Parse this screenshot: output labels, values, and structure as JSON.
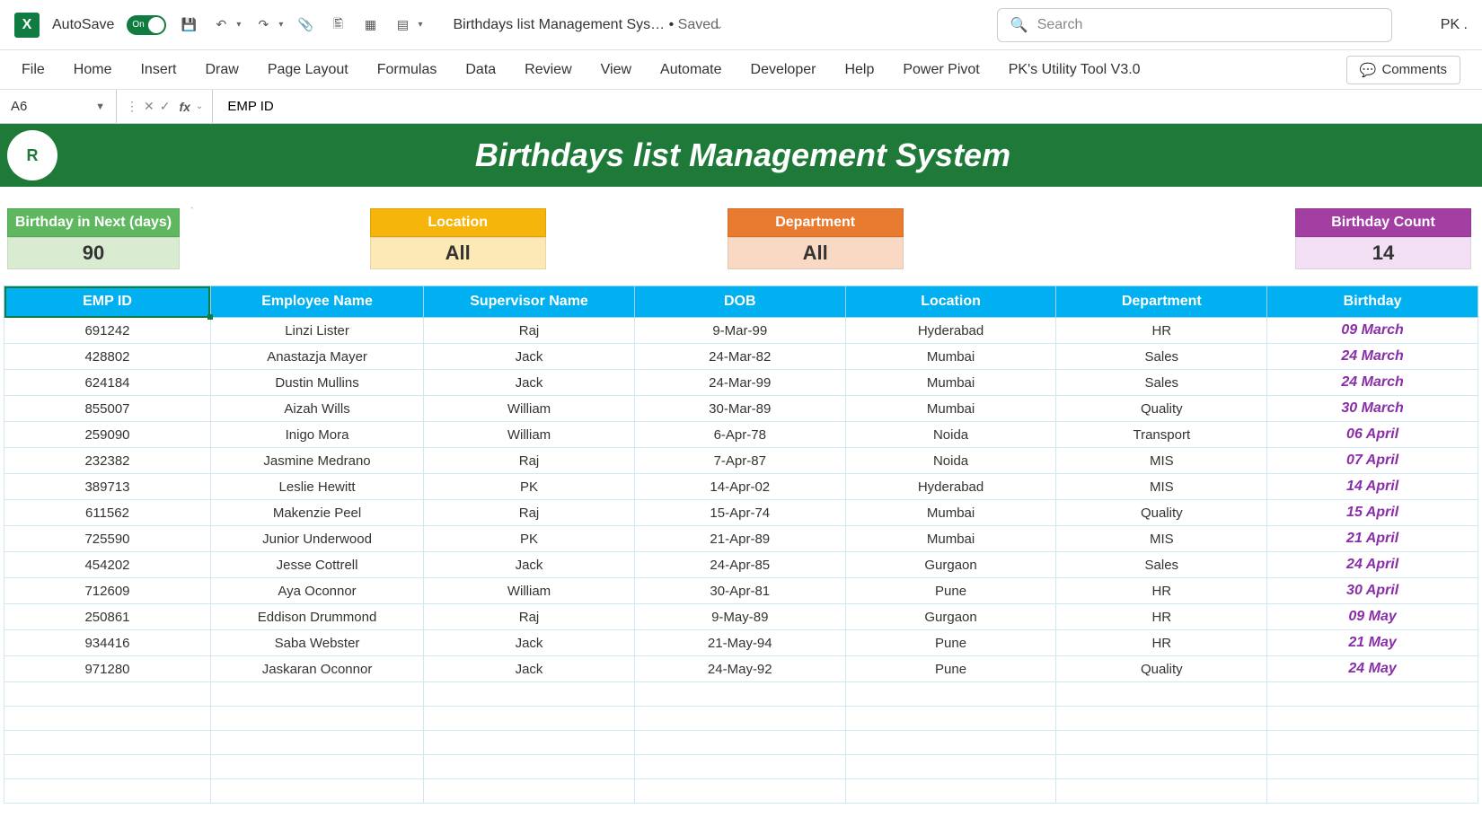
{
  "titlebar": {
    "autosave_label": "AutoSave",
    "autosave_state": "On",
    "doc_title": "Birthdays list Management Sys…",
    "saved_status": "Saved",
    "search_placeholder": "Search",
    "user": "PK ."
  },
  "ribbon": {
    "tabs": [
      "File",
      "Home",
      "Insert",
      "Draw",
      "Page Layout",
      "Formulas",
      "Data",
      "Review",
      "View",
      "Automate",
      "Developer",
      "Help",
      "Power Pivot",
      "PK's Utility Tool V3.0"
    ],
    "comments": "Comments"
  },
  "formula_bar": {
    "name_box": "A6",
    "formula": "EMP ID"
  },
  "sheet": {
    "title": "Birthdays list Management System",
    "filters": {
      "next_days_label": "Birthday in Next (days)",
      "next_days_value": "90",
      "location_label": "Location",
      "location_value": "All",
      "department_label": "Department",
      "department_value": "All",
      "count_label": "Birthday Count",
      "count_value": "14"
    },
    "colors": {
      "next_days_head": "#5fb85f",
      "next_days_val": "#d9ecd2",
      "location_head": "#f5b50a",
      "location_val": "#fce9b6",
      "department_head": "#e87b2f",
      "department_val": "#f9d9c3",
      "count_head": "#a33fa3",
      "count_val": "#f3dff3",
      "header_row": "#00b0f0",
      "title_bg": "#1f7a3a",
      "birthday_text": "#8a2da8"
    },
    "columns": [
      "EMP ID",
      "Employee Name",
      "Supervisor Name",
      "DOB",
      "Location",
      "Department",
      "Birthday"
    ],
    "col_widths": [
      "192px",
      "198px",
      "196px",
      "196px",
      "196px",
      "196px",
      "196px"
    ],
    "rows": [
      {
        "emp_id": "691242",
        "name": "Linzi Lister",
        "supervisor": "Raj",
        "dob": "9-Mar-99",
        "location": "Hyderabad",
        "department": "HR",
        "birthday": "09 March"
      },
      {
        "emp_id": "428802",
        "name": "Anastazja Mayer",
        "supervisor": "Jack",
        "dob": "24-Mar-82",
        "location": "Mumbai",
        "department": "Sales",
        "birthday": "24 March"
      },
      {
        "emp_id": "624184",
        "name": "Dustin Mullins",
        "supervisor": "Jack",
        "dob": "24-Mar-99",
        "location": "Mumbai",
        "department": "Sales",
        "birthday": "24 March"
      },
      {
        "emp_id": "855007",
        "name": "Aizah Wills",
        "supervisor": "William",
        "dob": "30-Mar-89",
        "location": "Mumbai",
        "department": "Quality",
        "birthday": "30 March"
      },
      {
        "emp_id": "259090",
        "name": "Inigo Mora",
        "supervisor": "William",
        "dob": "6-Apr-78",
        "location": "Noida",
        "department": "Transport",
        "birthday": "06 April"
      },
      {
        "emp_id": "232382",
        "name": "Jasmine Medrano",
        "supervisor": "Raj",
        "dob": "7-Apr-87",
        "location": "Noida",
        "department": "MIS",
        "birthday": "07 April"
      },
      {
        "emp_id": "389713",
        "name": "Leslie Hewitt",
        "supervisor": "PK",
        "dob": "14-Apr-02",
        "location": "Hyderabad",
        "department": "MIS",
        "birthday": "14 April"
      },
      {
        "emp_id": "611562",
        "name": "Makenzie Peel",
        "supervisor": "Raj",
        "dob": "15-Apr-74",
        "location": "Mumbai",
        "department": "Quality",
        "birthday": "15 April"
      },
      {
        "emp_id": "725590",
        "name": "Junior Underwood",
        "supervisor": "PK",
        "dob": "21-Apr-89",
        "location": "Mumbai",
        "department": "MIS",
        "birthday": "21 April"
      },
      {
        "emp_id": "454202",
        "name": "Jesse Cottrell",
        "supervisor": "Jack",
        "dob": "24-Apr-85",
        "location": "Gurgaon",
        "department": "Sales",
        "birthday": "24 April"
      },
      {
        "emp_id": "712609",
        "name": "Aya Oconnor",
        "supervisor": "William",
        "dob": "30-Apr-81",
        "location": "Pune",
        "department": "HR",
        "birthday": "30 April"
      },
      {
        "emp_id": "250861",
        "name": "Eddison Drummond",
        "supervisor": "Raj",
        "dob": "9-May-89",
        "location": "Gurgaon",
        "department": "HR",
        "birthday": "09 May"
      },
      {
        "emp_id": "934416",
        "name": "Saba Webster",
        "supervisor": "Jack",
        "dob": "21-May-94",
        "location": "Pune",
        "department": "HR",
        "birthday": "21 May"
      },
      {
        "emp_id": "971280",
        "name": "Jaskaran Oconnor",
        "supervisor": "Jack",
        "dob": "24-May-92",
        "location": "Pune",
        "department": "Quality",
        "birthday": "24 May"
      }
    ],
    "empty_rows": 5
  }
}
